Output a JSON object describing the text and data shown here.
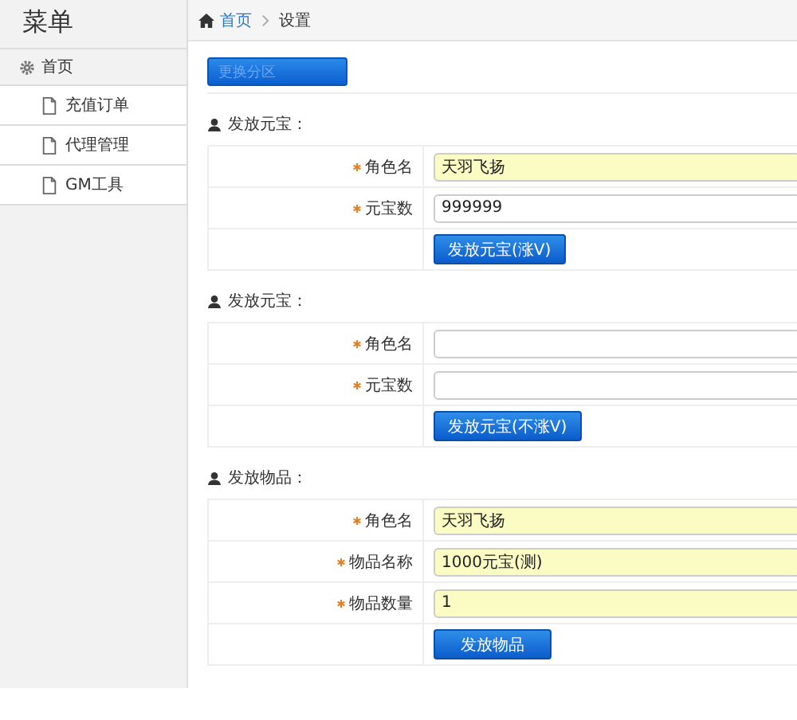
{
  "sidebar": {
    "title": "菜单",
    "items": [
      {
        "label": "首页",
        "kind": "home",
        "selected": false,
        "children": [
          {
            "label": "充值订单",
            "selected": false
          },
          {
            "label": "代理管理",
            "selected": false
          },
          {
            "label": "GM工具",
            "selected": false
          }
        ]
      }
    ]
  },
  "breadcrumb": [
    {
      "label": "首页",
      "kind": "link"
    },
    {
      "label": "设置",
      "kind": "current"
    }
  ],
  "top_button": {
    "label": "更换分区"
  },
  "sections": [
    {
      "title": "发放元宝：",
      "fields": [
        {
          "label": "角色名",
          "required": true,
          "value": "天羽飞扬",
          "autofilled": true
        },
        {
          "label": "元宝数",
          "required": true,
          "value": "999999",
          "autofilled": false
        }
      ],
      "button": "发放元宝(涨V)"
    },
    {
      "title": "发放元宝：",
      "fields": [
        {
          "label": "角色名",
          "required": true,
          "autofilled": false
        },
        {
          "label": "元宝数",
          "required": true,
          "autofilled": false
        }
      ],
      "button": "发放元宝(不涨V)"
    },
    {
      "title": "发放物品：",
      "fields": [
        {
          "label": "角色名",
          "required": true,
          "value": "天羽飞扬",
          "autofilled": true
        },
        {
          "label": "物品名称",
          "required": true,
          "value": "1000元宝(测)",
          "autofilled": true
        },
        {
          "label": "物品数量",
          "required": true,
          "value": "1",
          "autofilled": true
        }
      ],
      "button": "发放物品"
    }
  ]
}
